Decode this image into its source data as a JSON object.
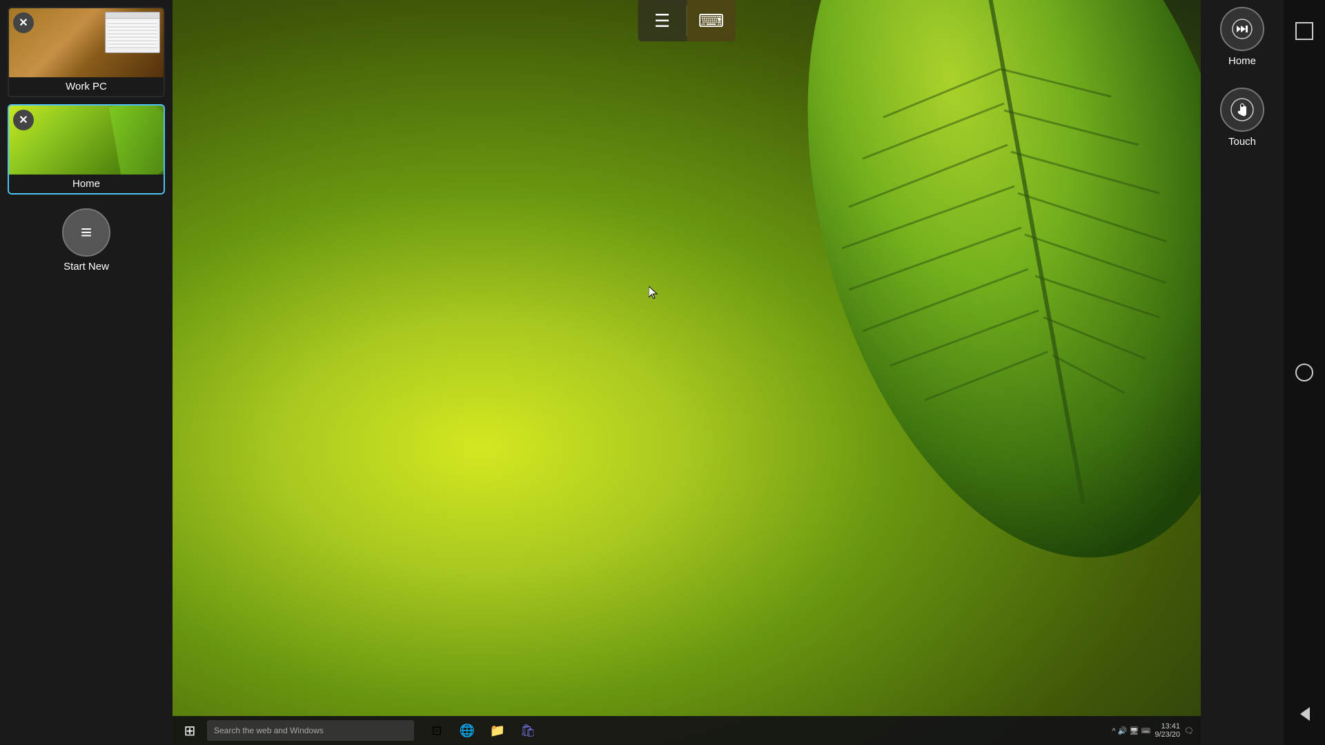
{
  "sidebar": {
    "sessions": [
      {
        "id": "work-pc",
        "label": "Work PC",
        "active": false,
        "thumbnail_type": "work-pc"
      },
      {
        "id": "home",
        "label": "Home",
        "active": true,
        "thumbnail_type": "home"
      }
    ],
    "start_new_label": "Start New"
  },
  "toolbar": {
    "menu_icon": "☰",
    "keyboard_icon": "⌨"
  },
  "right_sidebar": {
    "home_label": "Home",
    "touch_label": "Touch"
  },
  "taskbar": {
    "search_placeholder": "Search the web and Windows",
    "time": "13:41",
    "date": "9/23/20",
    "icons": [
      "⊡",
      "e",
      "📁",
      "🛒"
    ]
  },
  "wallpaper": {
    "description": "Green leaf macro wallpaper"
  }
}
